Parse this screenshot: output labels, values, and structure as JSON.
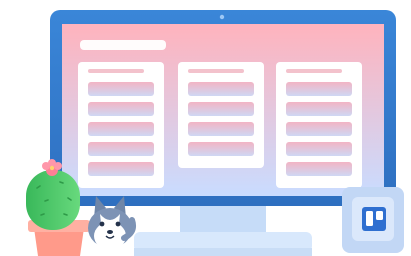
{
  "illustration": {
    "subject": "monitor-with-board",
    "lists": [
      {
        "cards": 5
      },
      {
        "cards": 4
      },
      {
        "cards": 5
      }
    ],
    "colors": {
      "monitor_bezel": "#3a86d8",
      "monitor_bezel_dark": "#2e6fc0",
      "screen_top": "#ffb3bd",
      "screen_bottom": "#c9dcff",
      "list_bg": "#ffffff",
      "card_top": "#f2b4c4",
      "card_bottom": "#cfd8f4",
      "stand": "#c6dcf8",
      "base": "#d8e8fc",
      "app_badge": "#b9d0f4",
      "app_icon": "#2f6fd0",
      "cactus": "#4fc969",
      "flower": "#ff8aa0",
      "pot": "#ff9a8a"
    },
    "icons": [
      "board-app-icon",
      "cactus-icon",
      "husky-mascot-icon",
      "camera-icon"
    ]
  }
}
